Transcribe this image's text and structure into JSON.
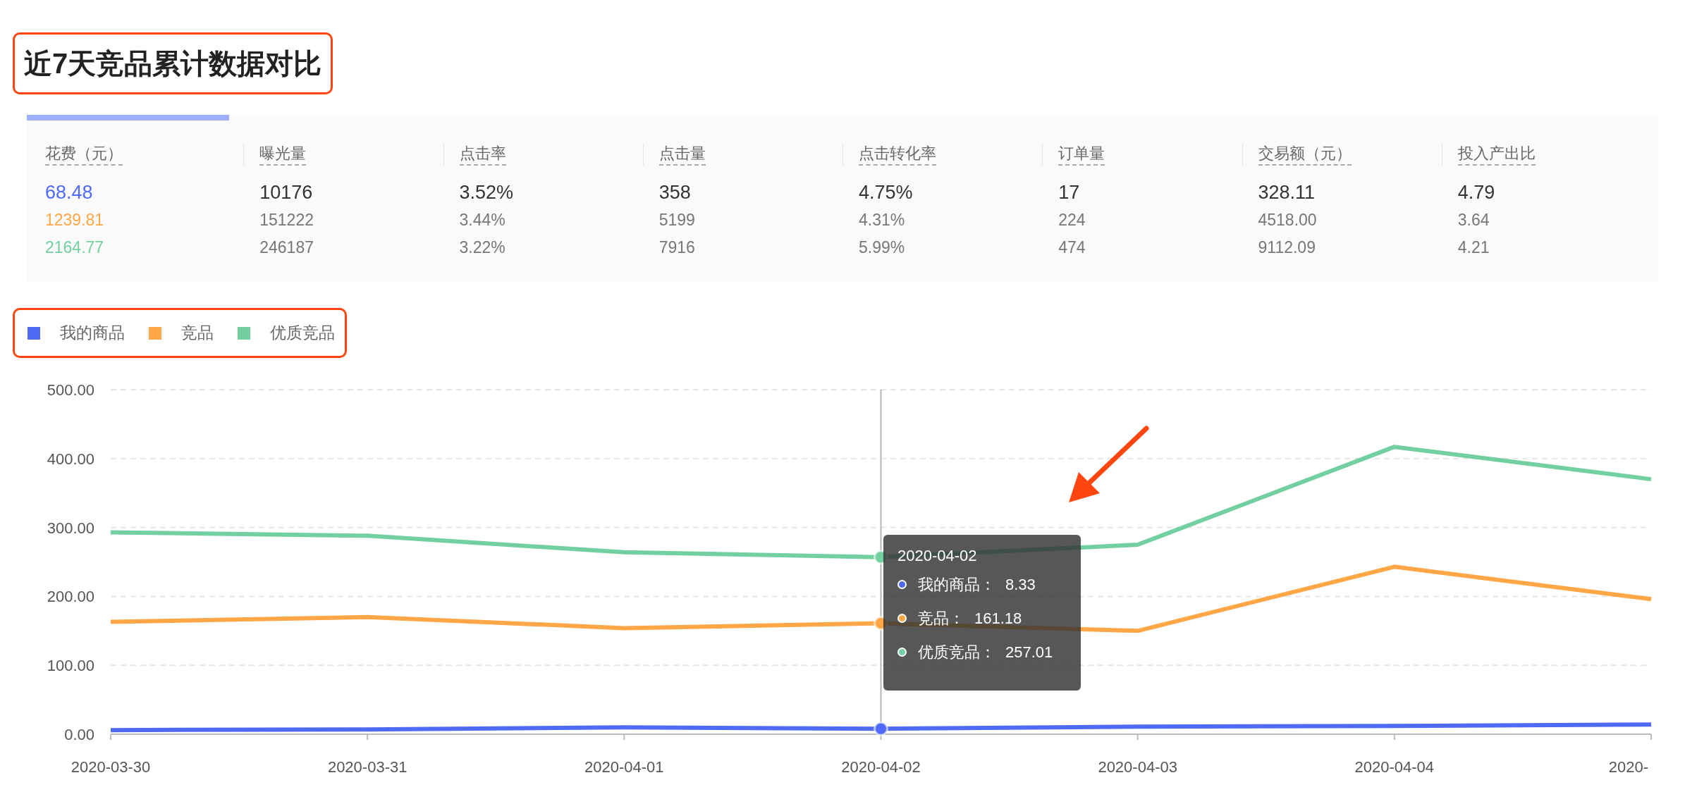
{
  "title": "近7天竞品累计数据对比",
  "table": {
    "columns": [
      "花费（元）",
      "曝光量",
      "点击率",
      "点击量",
      "点击转化率",
      "订单量",
      "交易额（元）",
      "投入产出比"
    ],
    "rows": [
      {
        "kind": "current",
        "color": "#4f6bf6",
        "cells": [
          "68.48",
          "10176",
          "3.52%",
          "358",
          "4.75%",
          "17",
          "328.11",
          "4.79"
        ]
      },
      {
        "kind": "compare",
        "color": "#ffa646",
        "cells": [
          "1239.81",
          "151222",
          "3.44%",
          "5199",
          "4.31%",
          "224",
          "4518.00",
          "3.64"
        ]
      },
      {
        "kind": "compare",
        "color": "#72d0a0",
        "cells": [
          "2164.77",
          "246187",
          "3.22%",
          "7916",
          "5.99%",
          "474",
          "9112.09",
          "4.21"
        ]
      }
    ]
  },
  "chart": {
    "chart_data": {
      "type": "line",
      "grid": true,
      "categories": [
        "2020-03-30",
        "2020-03-31",
        "2020-04-01",
        "2020-04-02",
        "2020-04-03",
        "2020-04-04",
        "2020-"
      ],
      "series": [
        {
          "name": "我的商品",
          "color": "#4f6bf6",
          "values": [
            6,
            7,
            10,
            8,
            11,
            12,
            14
          ]
        },
        {
          "name": "竞品",
          "color": "#ffa646",
          "values": [
            163,
            170,
            154,
            161,
            150,
            243,
            196
          ]
        },
        {
          "name": "优质竞品",
          "color": "#72d0a0",
          "values": [
            293,
            288,
            264,
            257,
            275,
            417,
            370
          ]
        }
      ],
      "ylim": [
        0,
        500
      ],
      "ref_lines": [
        {
          "axis": "x",
          "value": "2020-04-02"
        }
      ],
      "yticks": [
        {
          "value": 0,
          "label": "0.00"
        },
        {
          "value": 100,
          "label": "100.00"
        },
        {
          "value": 200,
          "label": "200.00"
        },
        {
          "value": 300,
          "label": "300.00"
        },
        {
          "value": 400,
          "label": "400.00"
        },
        {
          "value": 500,
          "label": "500.00"
        }
      ]
    },
    "tooltip": {
      "title": "2020-04-02",
      "rows": [
        {
          "label": "我的商品：",
          "value": "8.33",
          "color": "#4f6bf6"
        },
        {
          "label": "竞品：",
          "value": "161.18",
          "color": "#ffa646"
        },
        {
          "label": "优质竞品：",
          "value": "257.01",
          "color": "#72d0a0"
        }
      ]
    }
  }
}
